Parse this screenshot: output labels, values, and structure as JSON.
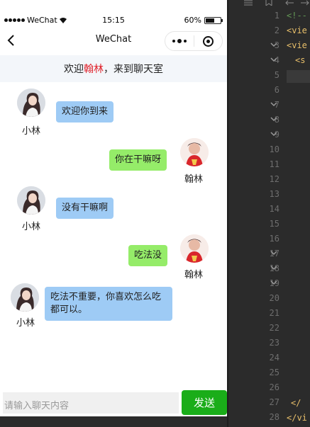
{
  "status_bar": {
    "carrier": "WeChat",
    "time": "15:15",
    "battery": "60%"
  },
  "nav": {
    "title": "WeChat"
  },
  "welcome": {
    "prefix": "欢迎",
    "name": "翰林",
    "suffix": "，来到聊天室"
  },
  "messages": [
    {
      "side": "left",
      "user": "小林",
      "text": "欢迎你到来"
    },
    {
      "side": "right",
      "user": "翰林",
      "text": "你在干嘛呀"
    },
    {
      "side": "left",
      "user": "小林",
      "text": "没有干嘛啊"
    },
    {
      "side": "right",
      "user": "翰林",
      "text": "吃法没"
    },
    {
      "side": "left",
      "user": "小林",
      "text": "吃法不重要，你喜欢怎么吃都可以。"
    }
  ],
  "input": {
    "placeholder": "请输入聊天内容",
    "send_label": "发送"
  },
  "editor": {
    "line_numbers": [
      "1",
      "2",
      "3",
      "4",
      "5",
      "6",
      "7",
      "8",
      "9",
      "10",
      "11",
      "12",
      "13",
      "14",
      "15",
      "16",
      "17",
      "18",
      "19",
      "20",
      "21",
      "22",
      "23",
      "24",
      "25",
      "26",
      "27",
      "28"
    ],
    "code": {
      "line1": "<!--",
      "line2": "<vie",
      "line3": "<vie",
      "line4": "<s",
      "line27": "</",
      "line28": "</vi"
    }
  },
  "colors": {
    "send": "#1aad19",
    "bubble_left": "#9ecbf5",
    "bubble_right": "#95ec69",
    "highlight_name": "#e0242d"
  }
}
